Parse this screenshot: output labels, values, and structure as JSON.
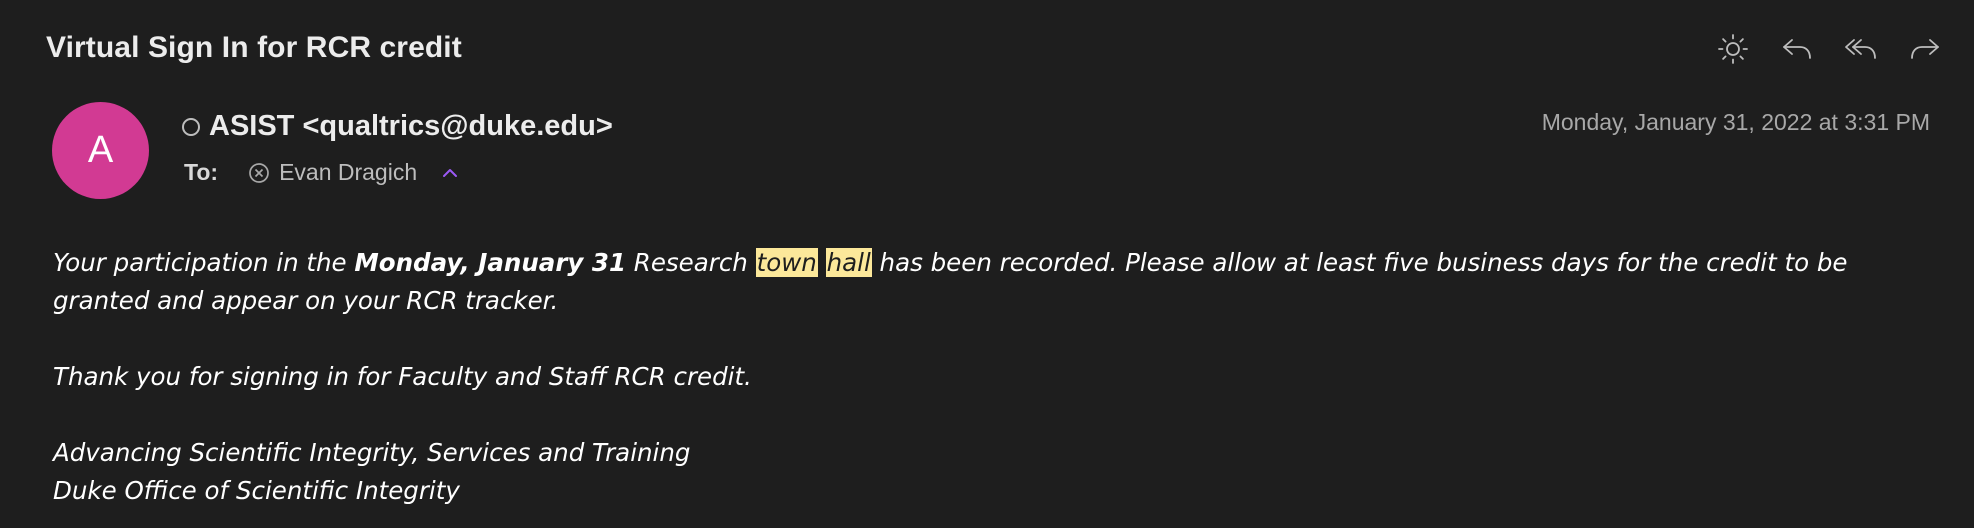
{
  "email": {
    "subject": "Virtual Sign In for RCR credit",
    "sender": {
      "avatar_letter": "A",
      "avatar_color": "#d23a93",
      "display": "ASIST <qualtrics@duke.edu>"
    },
    "date": "Monday, January 31, 2022 at 3:31 PM",
    "to_label": "To:",
    "recipient": "Evan Dragich",
    "body": {
      "p1_a": "Your participation in the ",
      "p1_bold": "Monday, January 31",
      "p1_b": " Research ",
      "p1_hl1": "town",
      "p1_space": " ",
      "p1_hl2": "hall",
      "p1_c": " has been recorded. Please allow at least five business days for the credit to be granted and appear on your RCR tracker.",
      "p2": "Thank you for signing in for Faculty and Staff RCR credit.",
      "sig1": "Advancing Scientific Integrity, Services and Training",
      "sig2": "Duke Office of Scientific Integrity"
    }
  },
  "toolbar": {
    "icons": [
      "appearance-icon",
      "reply-icon",
      "reply-all-icon",
      "forward-icon"
    ]
  },
  "colors": {
    "background": "#1e1e1e",
    "highlight": "#fce89a",
    "accent": "#9b59f5"
  }
}
